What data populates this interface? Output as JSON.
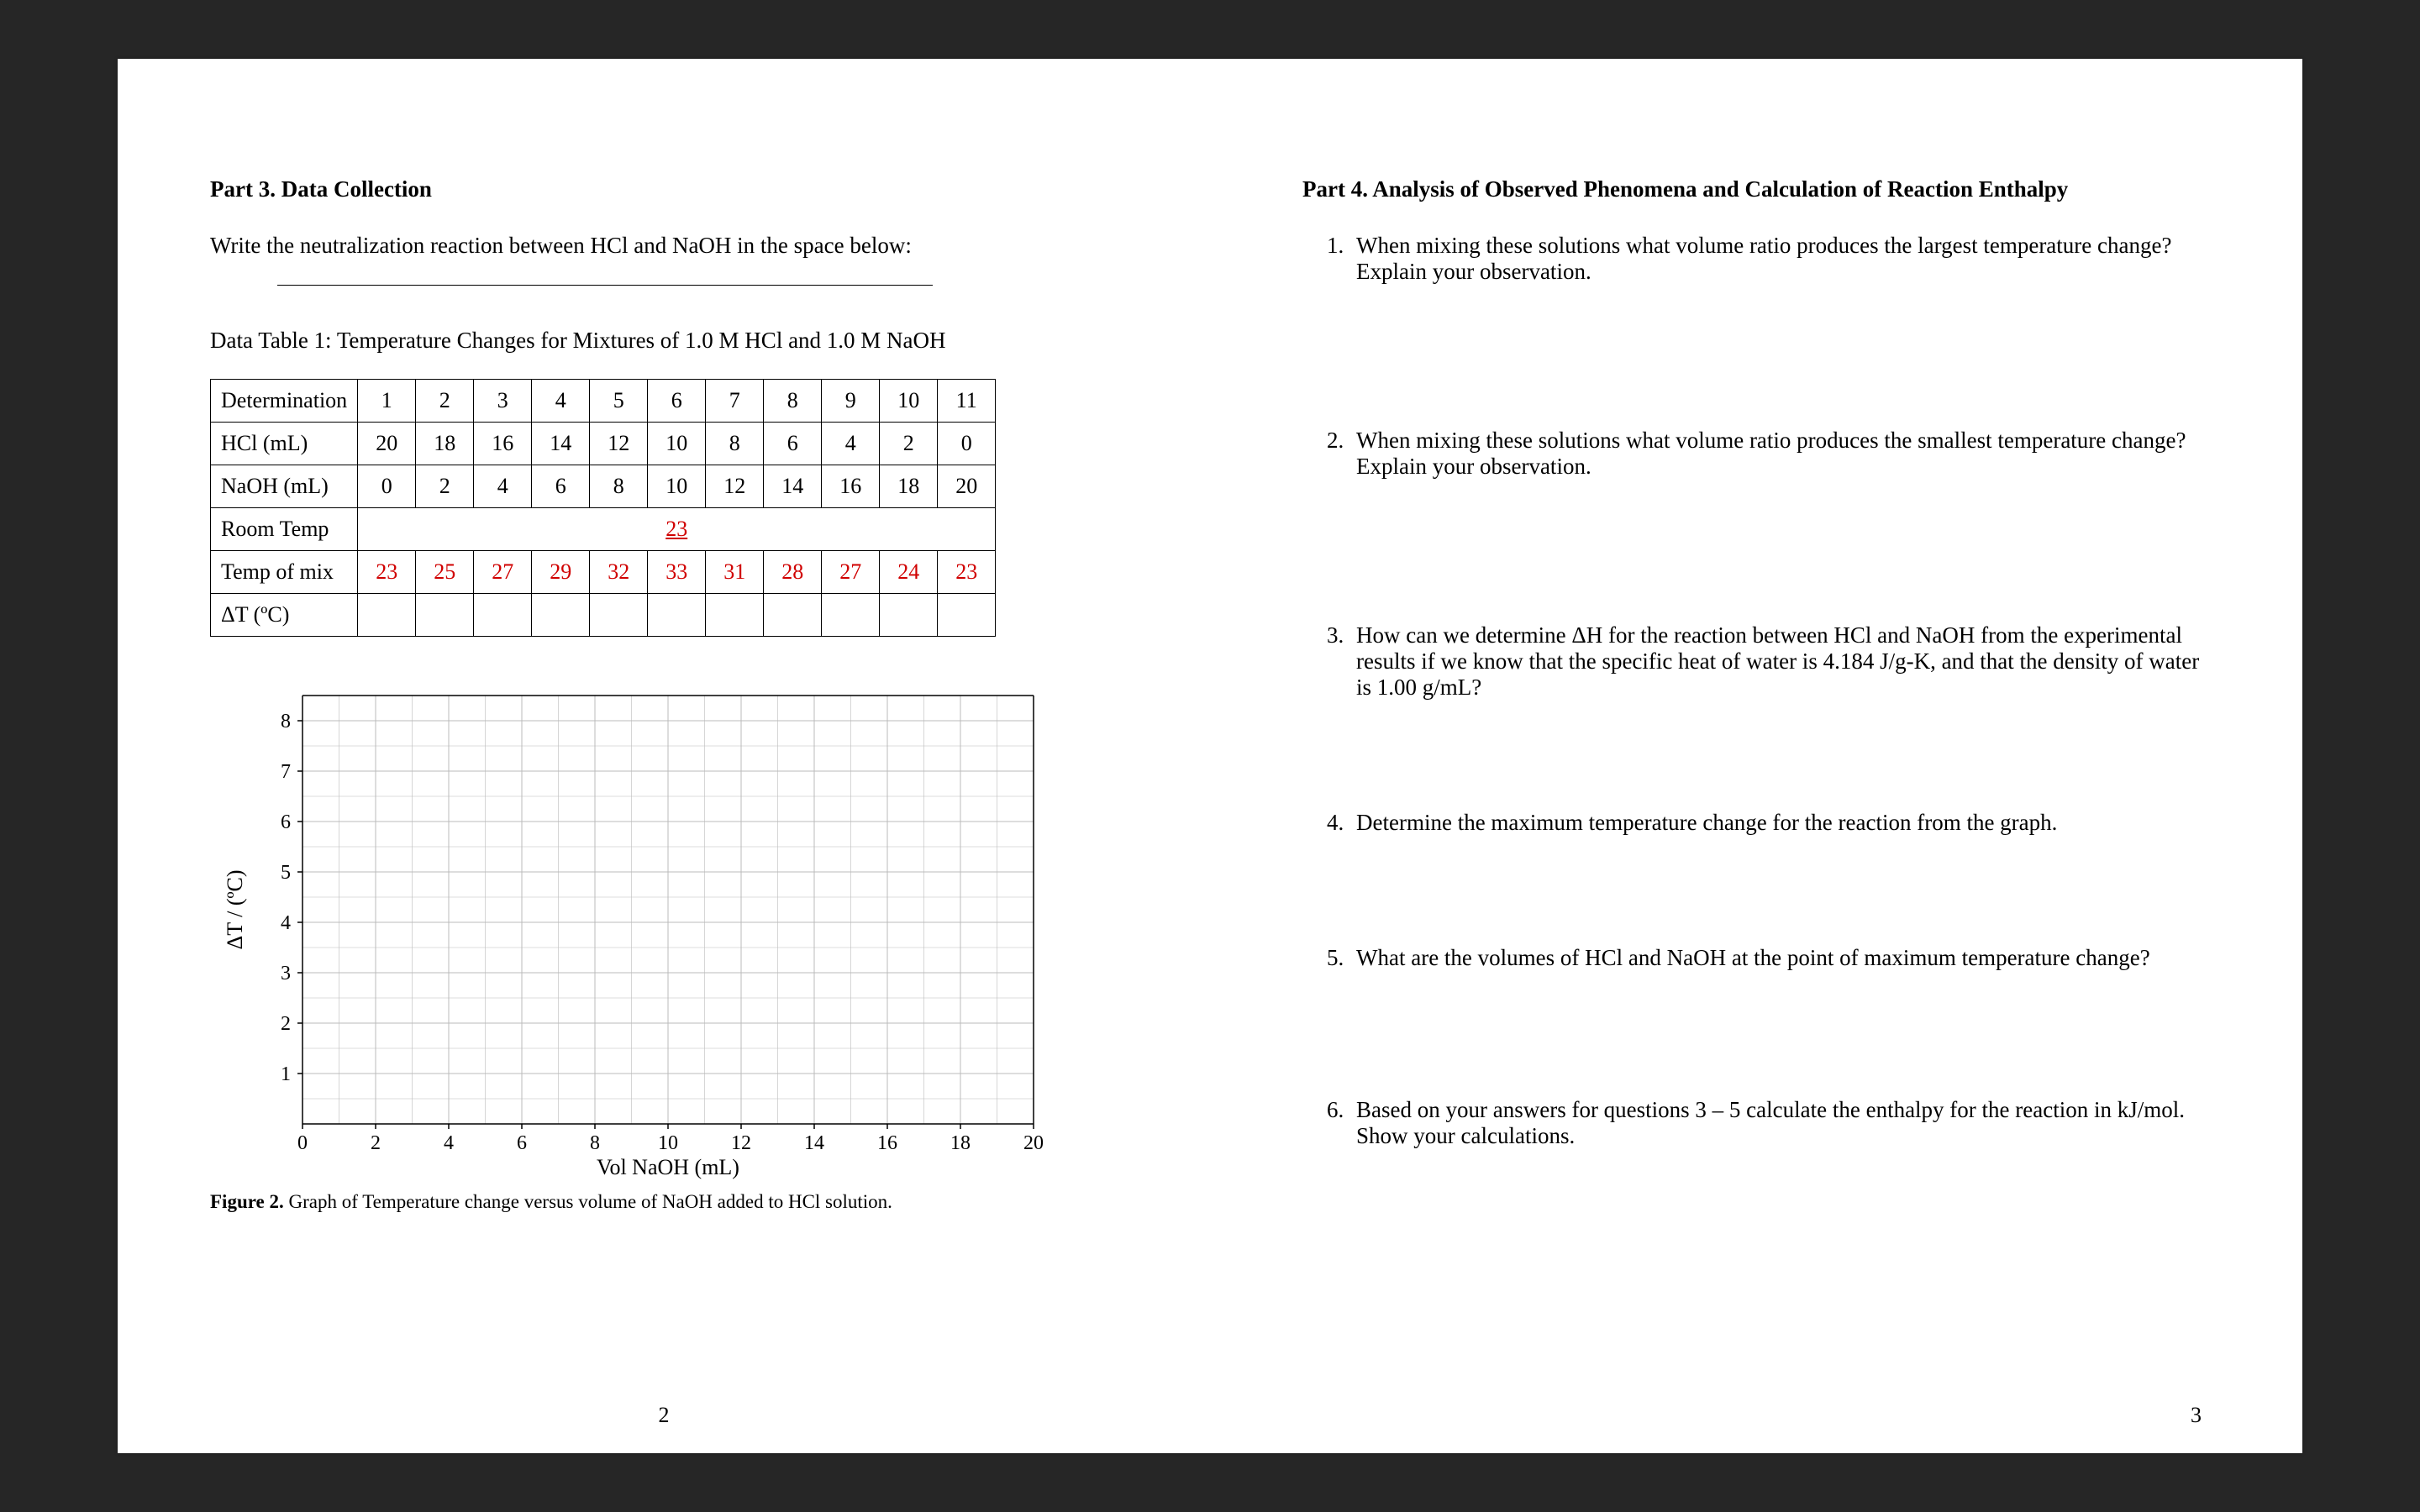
{
  "left": {
    "heading": "Part 3. Data Collection",
    "instruction": "Write the neutralization reaction between HCl and NaOH in the space below:",
    "table_title": "Data Table 1: Temperature Changes for Mixtures of 1.0 M HCl and 1.0 M NaOH",
    "rows": {
      "determination": {
        "label": "Determination",
        "cells": [
          "1",
          "2",
          "3",
          "4",
          "5",
          "6",
          "7",
          "8",
          "9",
          "10",
          "11"
        ]
      },
      "hcl": {
        "label": "HCl (mL)",
        "cells": [
          "20",
          "18",
          "16",
          "14",
          "12",
          "10",
          "8",
          "6",
          "4",
          "2",
          "0"
        ]
      },
      "naoh": {
        "label": "NaOH (mL)",
        "cells": [
          "0",
          "2",
          "4",
          "6",
          "8",
          "10",
          "12",
          "14",
          "16",
          "18",
          "20"
        ]
      },
      "room": {
        "label": "Room Temp",
        "value": "23"
      },
      "mix": {
        "label": "Temp of mix",
        "cells": [
          "23",
          "25",
          "27",
          "29",
          "32",
          "33",
          "31",
          "28",
          "27",
          "24",
          "23"
        ]
      },
      "dt": {
        "label": "ΔT (ºC)"
      }
    },
    "figure_caption_label": "Figure 2.",
    "figure_caption_text": " Graph of Temperature change versus volume of NaOH added to HCl solution.",
    "page_number": "2"
  },
  "right": {
    "heading": "Part 4. Analysis of Observed Phenomena and Calculation of Reaction Enthalpy",
    "q1": "When mixing these solutions what volume ratio produces the largest temperature change? Explain your observation.",
    "q2": "When mixing these solutions what volume ratio produces the smallest temperature change? Explain your observation.",
    "q3": "How can we determine ΔH for the reaction between HCl and NaOH from the experimental results if we know that the specific heat of water is 4.184 J/g-K, and that the density of water is 1.00 g/mL?",
    "q4": "Determine the maximum temperature change for the reaction from the graph.",
    "q5": "What are the volumes of HCl and NaOH at the point of maximum temperature change?",
    "q6": "Based on your answers for questions 3 – 5 calculate the enthalpy for the reaction in kJ/mol. Show your calculations.",
    "page_number": "3"
  },
  "chart_data": {
    "type": "scatter",
    "title": "",
    "xlabel": "Vol NaOH (mL)",
    "ylabel": "ΔT / (ºC)",
    "xlim": [
      0,
      20
    ],
    "ylim": [
      0,
      8.5
    ],
    "xticks": [
      0,
      2,
      4,
      6,
      8,
      10,
      12,
      14,
      16,
      18,
      20
    ],
    "yticks": [
      1,
      2,
      3,
      4,
      5,
      6,
      7,
      8
    ],
    "minor_grid": true,
    "series": []
  }
}
